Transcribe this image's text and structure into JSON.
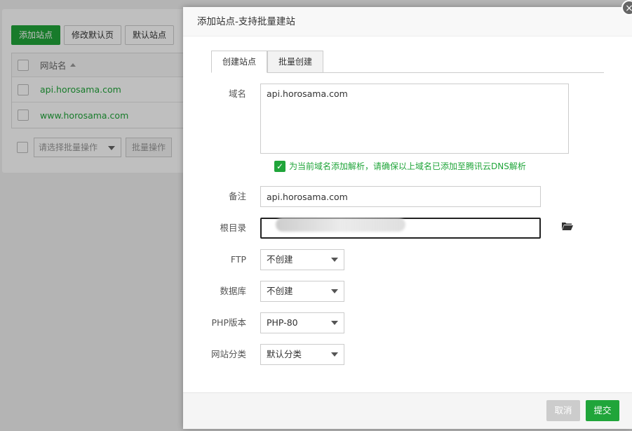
{
  "background": {
    "toolbar": {
      "add_site": "添加站点",
      "edit_default_page": "修改默认页",
      "default_site": "默认站点"
    },
    "table": {
      "header_site_name": "网站名",
      "rows": [
        "api.horosama.com",
        "www.horosama.com"
      ]
    },
    "batch": {
      "select_placeholder": "请选择批量操作",
      "batch_button": "批量操作"
    }
  },
  "modal": {
    "title": "添加站点-支持批量建站",
    "close_label": "×",
    "tabs": [
      {
        "label": "创建站点",
        "active": true
      },
      {
        "label": "批量创建",
        "active": false
      }
    ],
    "form": {
      "domain_label": "域名",
      "domain_value": "api.horosama.com",
      "dns_checkbox_checked": true,
      "dns_checkbox_label": "为当前域名添加解析，请确保以上域名已添加至腾讯云DNS解析",
      "remark_label": "备注",
      "remark_value": "api.horosama.com",
      "root_dir_label": "根目录",
      "root_dir_value": "",
      "ftp_label": "FTP",
      "ftp_value": "不创建",
      "db_label": "数据库",
      "db_value": "不创建",
      "php_label": "PHP版本",
      "php_value": "PHP-80",
      "category_label": "网站分类",
      "category_value": "默认分类"
    },
    "footer": {
      "cancel": "取消",
      "submit": "提交"
    }
  },
  "colors": {
    "accent_green": "#20a53a"
  }
}
